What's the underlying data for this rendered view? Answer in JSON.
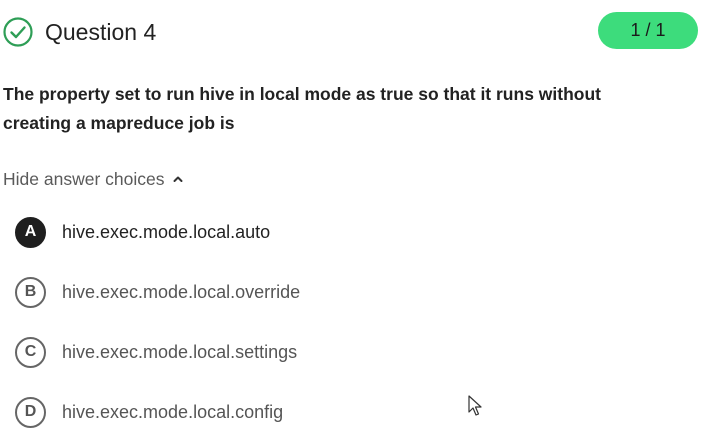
{
  "header": {
    "title": "Question 4",
    "score": "1 / 1",
    "status_icon": "check-circle-icon",
    "accent_color": "#3ddc7c",
    "check_color": "#2e9e56"
  },
  "question": {
    "prompt_line1": "The property set to run hive in local mode as true so that it runs without",
    "prompt_line2": "creating a mapreduce job is"
  },
  "toggle": {
    "label": "Hide answer choices",
    "icon": "chevron-up-icon"
  },
  "choices": [
    {
      "letter": "A",
      "text": "hive.exec.mode.local.auto",
      "selected": true
    },
    {
      "letter": "B",
      "text": "hive.exec.mode.local.override",
      "selected": false
    },
    {
      "letter": "C",
      "text": "hive.exec.mode.local.settings",
      "selected": false
    },
    {
      "letter": "D",
      "text": "hive.exec.mode.local.config",
      "selected": false
    }
  ]
}
